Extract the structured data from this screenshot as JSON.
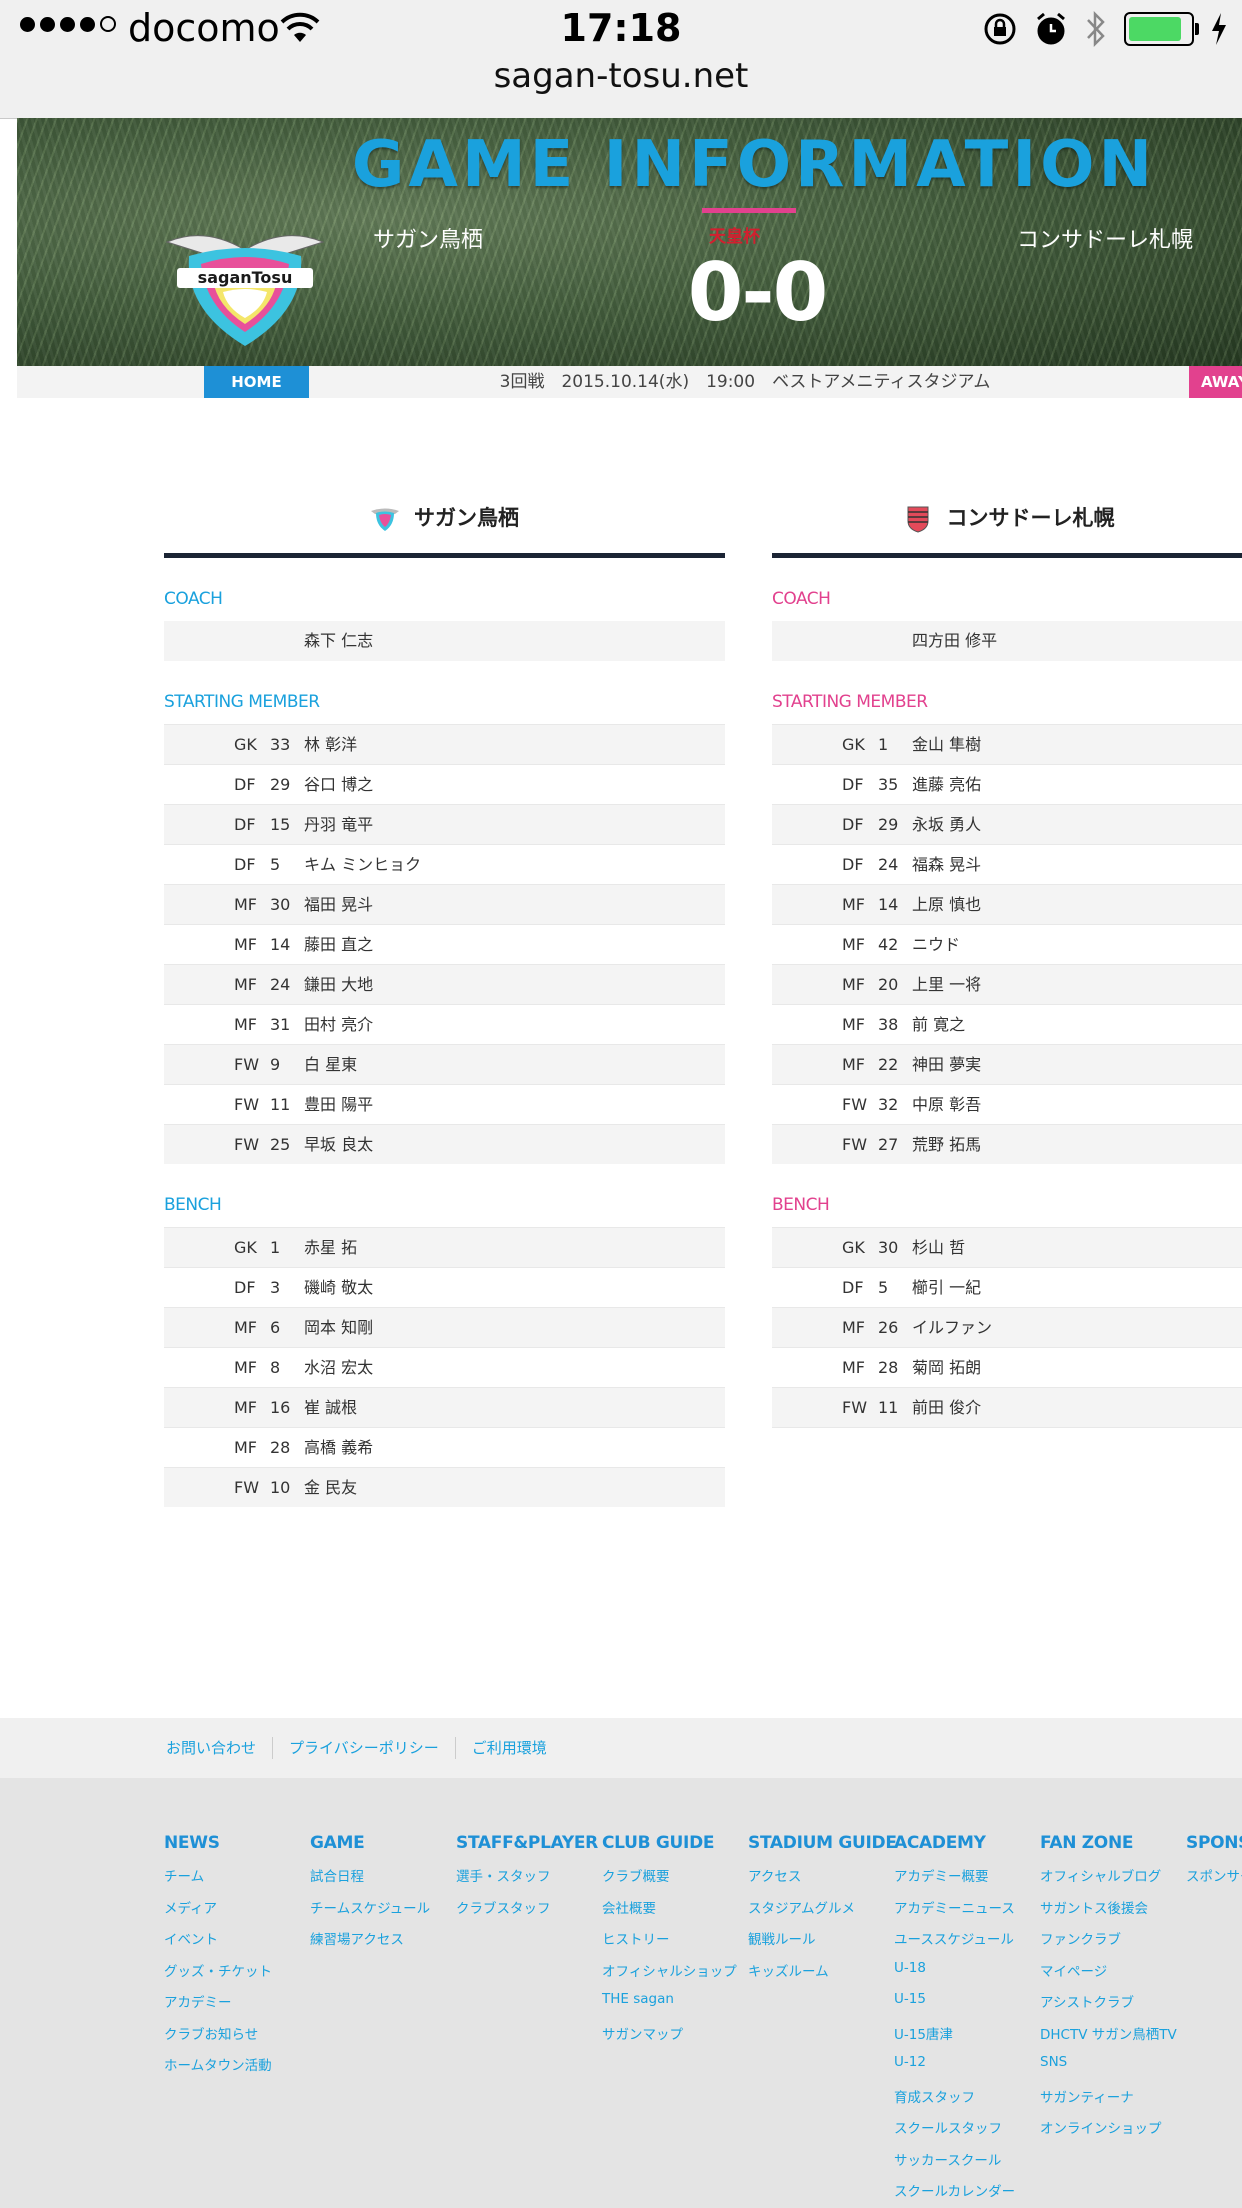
{
  "status": {
    "carrier": "docomo",
    "time": "17:18",
    "url": "sagan-tosu.net",
    "battery_level": 0.8
  },
  "hero": {
    "title": "GAME INFORMATION",
    "home_team": "サガン鳥栖",
    "away_team": "コンサドーレ札幌",
    "competition": "天皇杯",
    "score": "0-0",
    "crest_text": "saganTosu",
    "home_tag": "HOME",
    "away_tag": "AWAY",
    "match_info": "3回戦　2015.10.14(水)　19:00　ベストアメニティスタジアム"
  },
  "home": {
    "name": "サガン鳥栖",
    "coach_label": "COACH",
    "coach": "森下 仁志",
    "starting_label": "STARTING MEMBER",
    "starting": [
      {
        "pos": "GK",
        "num": "33",
        "name": "林 彰洋"
      },
      {
        "pos": "DF",
        "num": "29",
        "name": "谷口 博之"
      },
      {
        "pos": "DF",
        "num": "15",
        "name": "丹羽 竜平"
      },
      {
        "pos": "DF",
        "num": "5",
        "name": "キム ミンヒョク"
      },
      {
        "pos": "MF",
        "num": "30",
        "name": "福田 晃斗"
      },
      {
        "pos": "MF",
        "num": "14",
        "name": "藤田 直之"
      },
      {
        "pos": "MF",
        "num": "24",
        "name": "鎌田 大地"
      },
      {
        "pos": "MF",
        "num": "31",
        "name": "田村 亮介"
      },
      {
        "pos": "FW",
        "num": "9",
        "name": "白 星東"
      },
      {
        "pos": "FW",
        "num": "11",
        "name": "豊田 陽平"
      },
      {
        "pos": "FW",
        "num": "25",
        "name": "早坂 良太"
      }
    ],
    "bench_label": "BENCH",
    "bench": [
      {
        "pos": "GK",
        "num": "1",
        "name": "赤星 拓"
      },
      {
        "pos": "DF",
        "num": "3",
        "name": "磯崎 敬太"
      },
      {
        "pos": "MF",
        "num": "6",
        "name": "岡本 知剛"
      },
      {
        "pos": "MF",
        "num": "8",
        "name": "水沼 宏太"
      },
      {
        "pos": "MF",
        "num": "16",
        "name": "崔 誠根"
      },
      {
        "pos": "MF",
        "num": "28",
        "name": "高橋 義希"
      },
      {
        "pos": "FW",
        "num": "10",
        "name": "金 民友"
      }
    ]
  },
  "away": {
    "name": "コンサドーレ札幌",
    "coach_label": "COACH",
    "coach": "四方田 修平",
    "starting_label": "STARTING MEMBER",
    "starting": [
      {
        "pos": "GK",
        "num": "1",
        "name": "金山 隼樹"
      },
      {
        "pos": "DF",
        "num": "35",
        "name": "進藤 亮佑"
      },
      {
        "pos": "DF",
        "num": "29",
        "name": "永坂 勇人"
      },
      {
        "pos": "DF",
        "num": "24",
        "name": "福森 晃斗"
      },
      {
        "pos": "MF",
        "num": "14",
        "name": "上原 慎也"
      },
      {
        "pos": "MF",
        "num": "42",
        "name": "ニウド"
      },
      {
        "pos": "MF",
        "num": "20",
        "name": "上里 一将"
      },
      {
        "pos": "MF",
        "num": "38",
        "name": "前 寛之"
      },
      {
        "pos": "MF",
        "num": "22",
        "name": "神田 夢実"
      },
      {
        "pos": "FW",
        "num": "32",
        "name": "中原 彰吾"
      },
      {
        "pos": "FW",
        "num": "27",
        "name": "荒野 拓馬"
      }
    ],
    "bench_label": "BENCH",
    "bench": [
      {
        "pos": "GK",
        "num": "30",
        "name": "杉山 哲"
      },
      {
        "pos": "DF",
        "num": "5",
        "name": "櫛引 一紀"
      },
      {
        "pos": "MF",
        "num": "26",
        "name": "イルファン"
      },
      {
        "pos": "MF",
        "num": "28",
        "name": "菊岡 拓朗"
      },
      {
        "pos": "FW",
        "num": "11",
        "name": "前田 俊介"
      },
      {
        "pos": "",
        "num": "",
        "name": ""
      }
    ]
  },
  "footer": {
    "links": [
      "お問い合わせ",
      "プライバシーポリシー",
      "ご利用環境"
    ],
    "columns": [
      {
        "heading": "NEWS",
        "items": [
          "チーム",
          "メディア",
          "イベント",
          "グッズ・チケット",
          "アカデミー",
          "クラブお知らせ",
          "ホームタウン活動"
        ]
      },
      {
        "heading": "GAME",
        "items": [
          "試合日程",
          "チームスケジュール",
          "練習場アクセス"
        ]
      },
      {
        "heading": "STAFF&PLAYER",
        "items": [
          "選手・スタッフ",
          "クラブスタッフ"
        ]
      },
      {
        "heading": "CLUB GUIDE",
        "items": [
          "クラブ概要",
          "会社概要",
          "ヒストリー",
          "オフィシャルショップ",
          "THE sagan",
          "サガンマップ"
        ]
      },
      {
        "heading": "STADIUM GUIDE",
        "items": [
          "アクセス",
          "スタジアムグルメ",
          "観戦ルール",
          "キッズルーム"
        ]
      },
      {
        "heading": "ACADEMY",
        "items": [
          "アカデミー概要",
          "アカデミーニュース",
          "ユーススケジュール",
          "U-18",
          "U-15",
          "U-15唐津",
          "U-12",
          "育成スタッフ",
          "スクールスタッフ",
          "サッカースクール",
          "スクールカレンダー"
        ]
      },
      {
        "heading": "FAN ZONE",
        "items": [
          "オフィシャルブログ",
          "サガントス後援会",
          "ファンクラブ",
          "マイページ",
          "アシストクラブ",
          "DHCTV サガン鳥栖TV",
          "SNS",
          "サガンティーナ",
          "オンラインショップ"
        ]
      },
      {
        "heading": "SPONSOR",
        "items": [
          "スポンサー"
        ]
      }
    ]
  }
}
